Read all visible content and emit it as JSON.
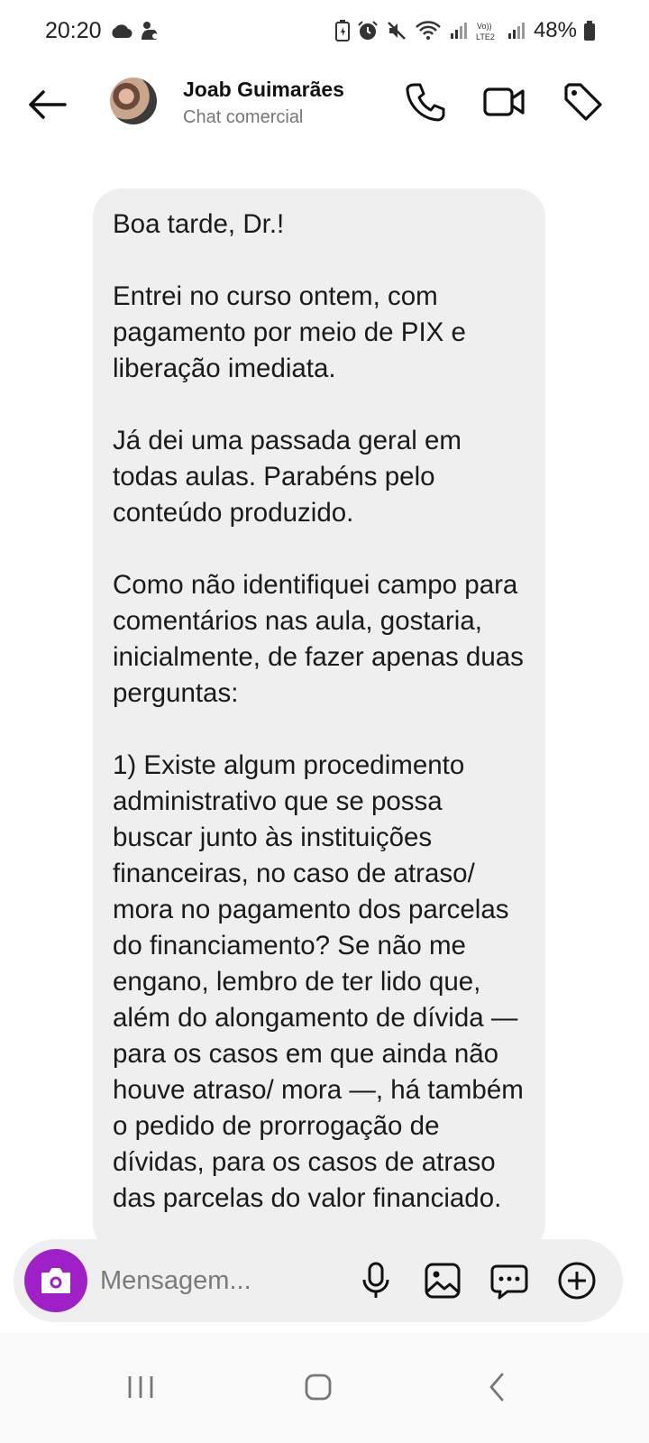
{
  "status_bar": {
    "time": "20:20",
    "battery": "48%",
    "icons": [
      "cloud-icon",
      "notification-icon",
      "battery-saver-icon",
      "alarm-icon",
      "mute-icon",
      "wifi-icon",
      "signal-icon",
      "volte-icon",
      "signal-icon",
      "battery-icon"
    ]
  },
  "header": {
    "name": "Joab Guimarães",
    "subtitle": "Chat comercial",
    "icons": [
      "back-arrow-icon",
      "phone-icon",
      "video-camera-icon",
      "tag-icon"
    ]
  },
  "message": {
    "text": "Boa tarde, Dr.!\n\nEntrei no curso ontem, com pagamento por meio de PIX e liberação imediata.\n\nJá dei uma passada geral em todas aulas. Parabéns pelo conteúdo produzido.\n\nComo não identifiquei campo para comentários nas aula, gostaria, inicialmente, de fazer apenas duas perguntas:\n\n1) Existe algum procedimento administrativo que se possa buscar junto às instituições financeiras, no caso de atraso/ mora no pagamento dos parcelas do financiamento? Se não me engano, lembro de ter lido que, além do alongamento de dívida — para os casos em que ainda não houve atraso/ mora —, há também o pedido de prorrogação de dívidas, para os casos de atraso das parcelas do valor financiado."
  },
  "composer": {
    "placeholder": "Mensagem...",
    "icons": [
      "camera-icon",
      "microphone-icon",
      "gallery-icon",
      "sticker-icon",
      "plus-icon"
    ],
    "accent_color": "#a020c8"
  },
  "nav_bar": {
    "icons": [
      "recents-icon",
      "home-icon",
      "back-icon"
    ]
  }
}
